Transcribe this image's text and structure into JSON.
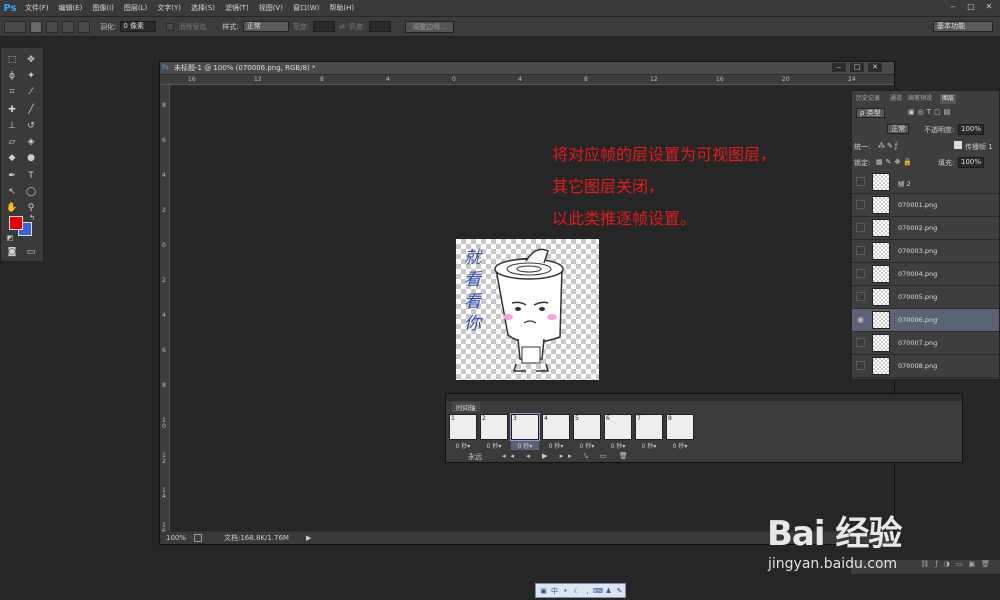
{
  "app": {
    "logo": "Ps"
  },
  "menu": [
    "文件(F)",
    "编辑(E)",
    "图像(I)",
    "图层(L)",
    "文字(Y)",
    "选择(S)",
    "滤镜(T)",
    "视图(V)",
    "窗口(W)",
    "帮助(H)"
  ],
  "options": {
    "feather_label": "羽化:",
    "feather_value": "0 像素",
    "antialias_label": "消除锯齿",
    "style_label": "样式:",
    "style_value": "正常",
    "width_label": "宽度:",
    "height_label": "高度:",
    "refine_edge": "调整边缘...",
    "workspace": "基本功能"
  },
  "doc": {
    "title": "未标题-1 @ 100% (070006.png, RGB/8) *",
    "zoom": "100%",
    "status": "文档:168.8K/1.76M",
    "ruler_h": [
      "16",
      "12",
      "8",
      "4",
      "0",
      "4",
      "8",
      "12",
      "16",
      "20",
      "24"
    ],
    "ruler_v": [
      "8",
      "6",
      "4",
      "2",
      "0",
      "2",
      "4",
      "6",
      "8",
      "1\n0",
      "1\n2",
      "1\n4",
      "1\n6"
    ]
  },
  "annotation": {
    "line1": "将对应帧的层设置为可视图层，",
    "line2": "其它图层关闭，",
    "line3": "以此类推逐帧设置。"
  },
  "image_text": "就看看你",
  "panel": {
    "tabs": [
      "历史记录",
      "通道",
      "画笔预设",
      "图层"
    ],
    "kind": "ρ 类型",
    "blend": "正常",
    "opacity_label": "不透明度:",
    "opacity": "100%",
    "unify": "统一:",
    "propagate": "传播帧 1",
    "lock": "锁定:",
    "fill_label": "填充:",
    "fill": "100%",
    "layers": [
      {
        "name": "帧 2",
        "visible": false
      },
      {
        "name": "070001.png",
        "visible": false
      },
      {
        "name": "070002.png",
        "visible": false
      },
      {
        "name": "070003.png",
        "visible": false
      },
      {
        "name": "070004.png",
        "visible": false
      },
      {
        "name": "070005.png",
        "visible": false
      },
      {
        "name": "070006.png",
        "visible": true,
        "selected": true
      },
      {
        "name": "070007.png",
        "visible": false
      },
      {
        "name": "070008.png",
        "visible": false
      }
    ]
  },
  "timeline": {
    "title": "时间轴",
    "frames": [
      {
        "n": "1",
        "delay": "0 秒▾"
      },
      {
        "n": "2",
        "delay": "0 秒▾"
      },
      {
        "n": "3",
        "delay": "0 秒▾",
        "selected": true
      },
      {
        "n": "4",
        "delay": "0 秒▾"
      },
      {
        "n": "5",
        "delay": "0 秒▾"
      },
      {
        "n": "6",
        "delay": "0 秒▾"
      },
      {
        "n": "7",
        "delay": "0 秒▾"
      },
      {
        "n": "8",
        "delay": "0 秒▾"
      }
    ],
    "loop": "永远"
  },
  "watermark": {
    "brand": "Bai 经验",
    "url": "jingyan.baidu.com"
  },
  "colors": {
    "foreground": "#e60000",
    "background": "#3a63d6",
    "annotation": "#e01b1b",
    "selected_layer": "#5a6273"
  }
}
